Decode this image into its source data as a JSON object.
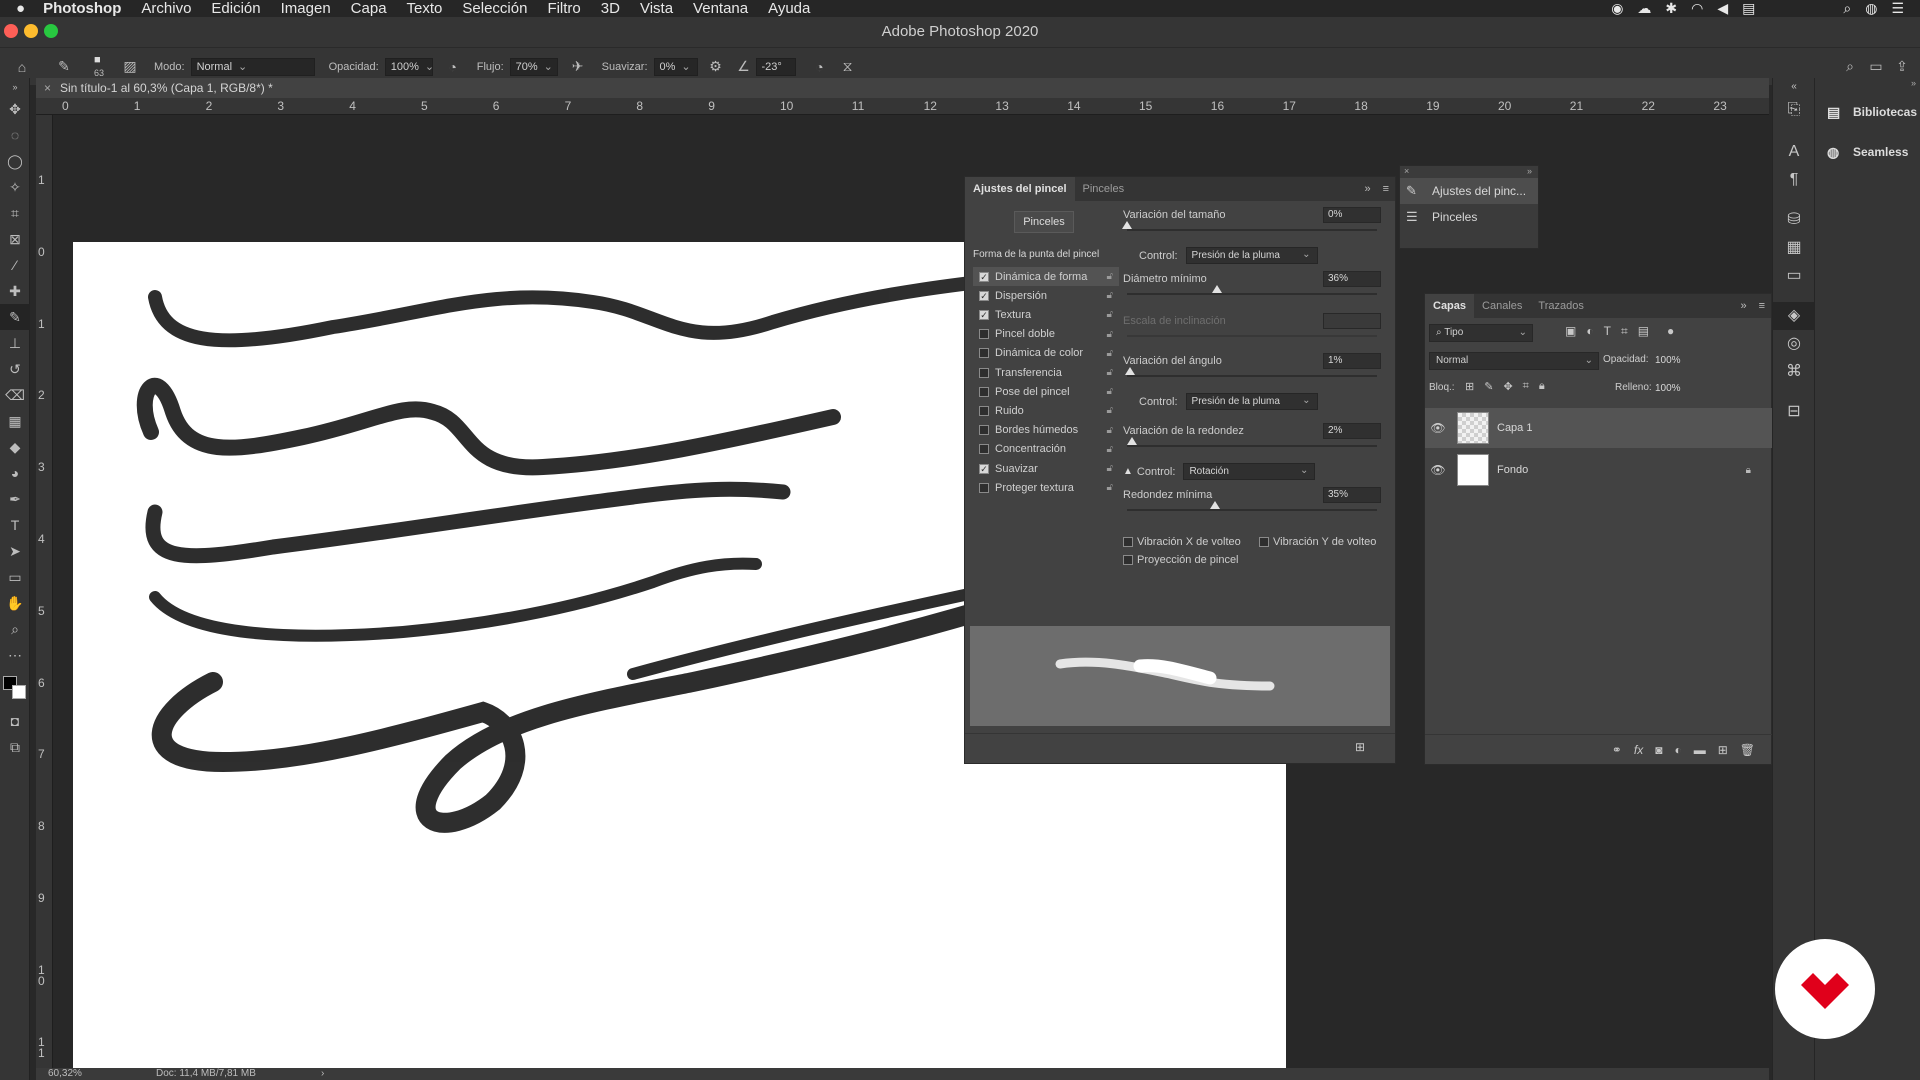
{
  "menubar": {
    "app": "Photoshop",
    "items": [
      "Archivo",
      "Edición",
      "Imagen",
      "Capa",
      "Texto",
      "Selección",
      "Filtro",
      "3D",
      "Vista",
      "Ventana",
      "Ayuda"
    ]
  },
  "window": {
    "title": "Adobe Photoshop 2020"
  },
  "options": {
    "brush_size": "63",
    "mode_label": "Modo:",
    "mode_value": "Normal",
    "opacity_label": "Opacidad:",
    "opacity_value": "100%",
    "flow_label": "Flujo:",
    "flow_value": "70%",
    "smooth_label": "Suavizar:",
    "smooth_value": "0%",
    "angle_value": "-23°"
  },
  "document": {
    "tab_title": "Sin título-1 al 60,3% (Capa 1, RGB/8*) *"
  },
  "ruler_h": [
    "0",
    "1",
    "2",
    "3",
    "4",
    "5",
    "6",
    "7",
    "8",
    "9",
    "10",
    "11",
    "12",
    "13",
    "14",
    "15",
    "16",
    "17",
    "18",
    "19",
    "20",
    "21",
    "22",
    "23"
  ],
  "ruler_v": [
    "1",
    "0",
    "1",
    "2",
    "3",
    "4",
    "5",
    "6",
    "7",
    "8",
    "9",
    "1\n0",
    "1\n1"
  ],
  "status": {
    "zoom": "60,32%",
    "doc": "Doc: 11,4 MB/7,81 MB"
  },
  "brush_panel": {
    "tabs": [
      "Ajustes del pincel",
      "Pinceles"
    ],
    "pinceles_button": "Pinceles",
    "section_title": "Forma de la punta del pincel",
    "options": [
      {
        "label": "Dinámica de forma",
        "checked": true
      },
      {
        "label": "Dispersión",
        "checked": true
      },
      {
        "label": "Textura",
        "checked": true
      },
      {
        "label": "Pincel doble",
        "checked": false
      },
      {
        "label": "Dinámica de color",
        "checked": false
      },
      {
        "label": "Transferencia",
        "checked": false
      },
      {
        "label": "Pose del pincel",
        "checked": false
      },
      {
        "label": "Ruido",
        "checked": false
      },
      {
        "label": "Bordes húmedos",
        "checked": false
      },
      {
        "label": "Concentración",
        "checked": false
      },
      {
        "label": "Suavizar",
        "checked": true
      },
      {
        "label": "Proteger textura",
        "checked": false
      }
    ],
    "size_jitter": {
      "label": "Variación del tamaño",
      "value": "0%",
      "level": 0.0
    },
    "control_1": {
      "label": "Control:",
      "value": "Presión de la pluma"
    },
    "min_diameter": {
      "label": "Diámetro mínimo",
      "value": "36%",
      "level": 0.36
    },
    "tilt_scale": {
      "label": "Escala de inclinación"
    },
    "angle_jitter": {
      "label": "Variación del ángulo",
      "value": "1%",
      "level": 0.01
    },
    "control_2": {
      "label": "Control:",
      "value": "Presión de la pluma"
    },
    "roundness_jitter": {
      "label": "Variación de la redondez",
      "value": "2%",
      "level": 0.02
    },
    "control_3": {
      "label": "Control:",
      "value": "Rotación"
    },
    "min_roundness": {
      "label": "Redondez mínima",
      "value": "35%",
      "level": 0.35
    },
    "flip_x": "Vibración X de volteo",
    "flip_y": "Vibración Y de volteo",
    "projection": "Proyección de pincel"
  },
  "mini_panel": {
    "items": [
      "Ajustes del pinc...",
      "Pinceles"
    ]
  },
  "layers_panel": {
    "tabs": [
      "Capas",
      "Canales",
      "Trazados"
    ],
    "filter": "Tipo",
    "blend": "Normal",
    "opacity_label": "Opacidad:",
    "opacity_value": "100%",
    "lock_label": "Bloq.:",
    "fill_label": "Relleno:",
    "fill_value": "100%",
    "layers": [
      {
        "name": "Capa 1"
      },
      {
        "name": "Fondo"
      }
    ]
  },
  "libraries": {
    "items": [
      "Bibliotecas",
      "Seamless"
    ]
  }
}
